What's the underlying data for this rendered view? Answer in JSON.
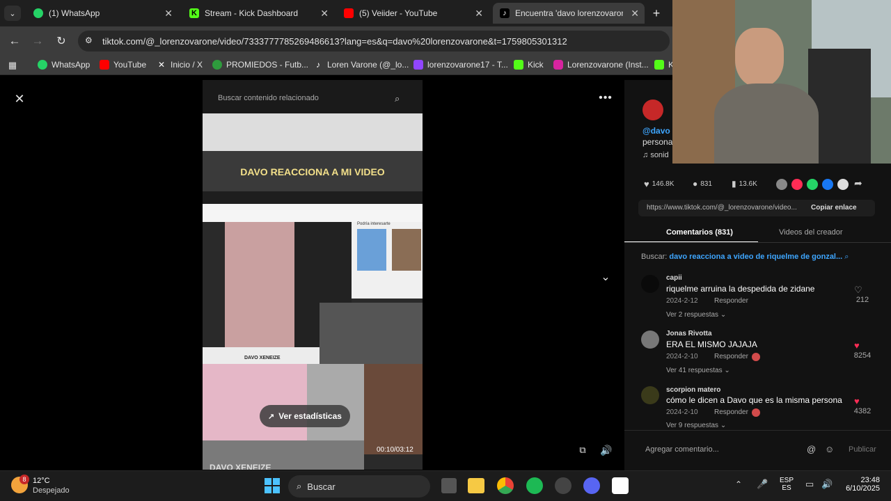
{
  "tabs": [
    {
      "title": "(1) WhatsApp",
      "color": "#25d366"
    },
    {
      "title": "Stream - Kick Dashboard",
      "color": "#53fc18"
    },
    {
      "title": "(5) Veiider - YouTube",
      "color": "#ff0000"
    },
    {
      "title": "Encuentra 'davo lorenzovarone",
      "color": "#ffffff"
    }
  ],
  "url": "tiktok.com/@_lorenzovarone/video/7333777785269486613?lang=es&q=davo%20lorenzovarone&t=1759805301312",
  "bookmarks": [
    {
      "label": "WhatsApp",
      "color": "#25d366"
    },
    {
      "label": "YouTube",
      "color": "#ff0000"
    },
    {
      "label": "Inicio / X",
      "color": "#ffffff"
    },
    {
      "label": "PROMIEDOS - Futb...",
      "color": "#2e9b3d"
    },
    {
      "label": "Loren Varone (@_lo...",
      "color": "#ffffff"
    },
    {
      "label": "lorenzovarone17 - T...",
      "color": "#9146ff"
    },
    {
      "label": "Kick",
      "color": "#53fc18"
    },
    {
      "label": "Lorenzovarone (Inst...",
      "color": "#d6249f"
    },
    {
      "label": "K",
      "color": "#53fc18"
    }
  ],
  "video": {
    "search_placeholder": "Buscar contenido relacionado",
    "caption": "DAVO REACCIONA A MI VIDEO",
    "related_title": "Podría interesarte",
    "stats_button": "Ver estadísticas",
    "time": "00:10/03:12",
    "banner1": "DAVO XENEIZE",
    "banner2": "DAVO XENEIZE"
  },
  "post": {
    "handle": "@davo",
    "desc": "persona",
    "sound": "sonid",
    "likes": "146.8K",
    "comments": "831",
    "saves": "13.6K",
    "link": "https://www.tiktok.com/@_lorenzovarone/video...",
    "copy_link": "Copiar enlace",
    "tab_comments": "Comentarios (831)",
    "tab_videos": "Videos del creador",
    "search_label": "Buscar:",
    "search_query": "davo reacciona a video de riquelme de gonzal..."
  },
  "comments": [
    {
      "user": "capii",
      "text": "riquelme arruina la despedida de zidane",
      "date": "2024-2-12",
      "reply": "Responder",
      "more": "Ver 2 respuestas",
      "likes": "212",
      "liked": false
    },
    {
      "user": "Jonas Rivotta",
      "text": "ERA EL MISMO JAJAJA",
      "date": "2024-2-10",
      "reply": "Responder",
      "more": "Ver 41 respuestas",
      "likes": "8254",
      "liked": true
    },
    {
      "user": "scorpion matero",
      "text": "cómo le dicen a Davo que es la misma persona",
      "date": "2024-2-10",
      "reply": "Responder",
      "more": "Ver 9 respuestas",
      "likes": "4382",
      "liked": true
    }
  ],
  "add_comment_placeholder": "Agregar comentario...",
  "publish": "Publicar",
  "taskbar": {
    "weather_temp": "12°C",
    "weather_desc": "Despejado",
    "weather_badge": "8",
    "search": "Buscar",
    "lang1": "ESP",
    "lang2": "ES",
    "time": "23:48",
    "date": "6/10/2025"
  }
}
